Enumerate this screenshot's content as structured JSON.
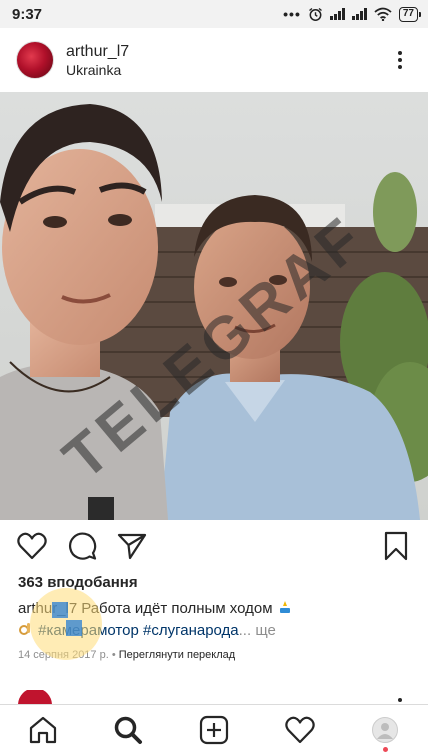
{
  "status_bar": {
    "time": "9:37",
    "battery": "77",
    "dots": "•••"
  },
  "post": {
    "username": "arthur_l7",
    "location": "Ukrainka",
    "likes": "363 вподобання",
    "caption_user": "arthur_l7",
    "caption_text": "Работа идёт полным ходом",
    "hashtags": [
      "#камерамотор",
      "#слуганарода"
    ],
    "ellipsis": "...",
    "more_label": "ще",
    "date": "14 серпня 2017 р.",
    "separator": "•",
    "translate_label": "Переглянути переклад",
    "caption_emoji_icon": "top-emoji-icon",
    "ok-emoji-icon": "ok-hand-emoji-icon"
  },
  "watermark": {
    "text": "TELEGRAF"
  },
  "colors": {
    "hashtag": "#003569",
    "notification_dot": "#ed4956",
    "secondary_text": "#8e8e8e"
  },
  "icons": {
    "like": "heart-icon",
    "comment": "comment-icon",
    "share": "send-icon",
    "save": "bookmark-icon",
    "home": "home-icon",
    "search": "search-icon",
    "new_post": "add-post-icon",
    "activity": "heart-icon",
    "profile": "profile-avatar"
  }
}
